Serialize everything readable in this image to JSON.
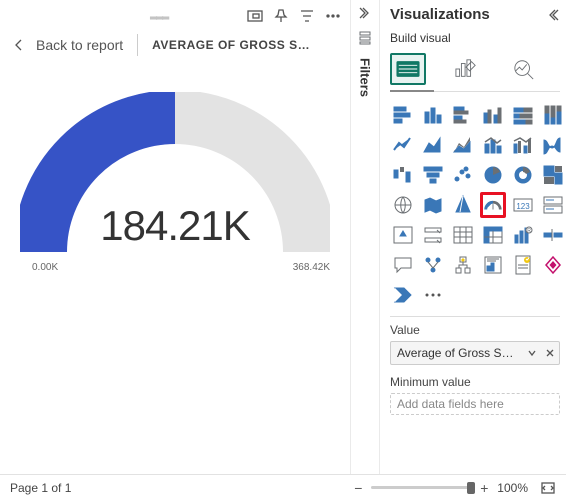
{
  "report": {
    "back_label": "Back to report",
    "title": "AVERAGE OF GROSS SAL…"
  },
  "toolbar": {
    "focus_icon": "focus-mode",
    "pin_icon": "pin",
    "filter_icon": "filter",
    "more_icon": "more"
  },
  "gauge": {
    "value_label": "184.21K",
    "min_label": "0.00K",
    "max_label": "368.42K"
  },
  "chart_data": {
    "type": "gauge",
    "title": "Average of Gross Sales",
    "value": 184.21,
    "min": 0.0,
    "max": 368.42,
    "units": "K",
    "fill_ratio": 0.5
  },
  "filters": {
    "label": "Filters"
  },
  "visualizations": {
    "title": "Visualizations",
    "build_label": "Build visual",
    "tabs": [
      "build-visual",
      "format-visual",
      "analytics"
    ],
    "viz_types": [
      "stacked-bar",
      "stacked-column",
      "clustered-bar",
      "clustered-column",
      "100-stacked-bar",
      "100-stacked-column",
      "line",
      "area",
      "stacked-area",
      "line-stacked-column",
      "line-clustered-column",
      "ribbon",
      "waterfall",
      "funnel",
      "scatter",
      "pie",
      "donut",
      "treemap",
      "map",
      "filled-map",
      "azure-map",
      "gauge",
      "card",
      "multi-row-card",
      "kpi",
      "slicer",
      "table",
      "matrix",
      "r-visual",
      "python-visual",
      "qna",
      "key-influencers",
      "decomposition-tree",
      "smart-narrative",
      "paginated-report",
      "powerapps",
      "power-automate",
      "more"
    ],
    "highlighted": "gauge",
    "value_section": "Value",
    "value_field": "Average of Gross Sales",
    "minimum_section": "Minimum value",
    "minimum_placeholder": "Add data fields here"
  },
  "footer": {
    "page_label": "Page 1 of 1",
    "zoom_label": "100%"
  },
  "colors": {
    "gauge_fill": "#3653c6",
    "gauge_track": "#e3e3e3",
    "highlight": "#e81123",
    "teal": "#117865"
  }
}
